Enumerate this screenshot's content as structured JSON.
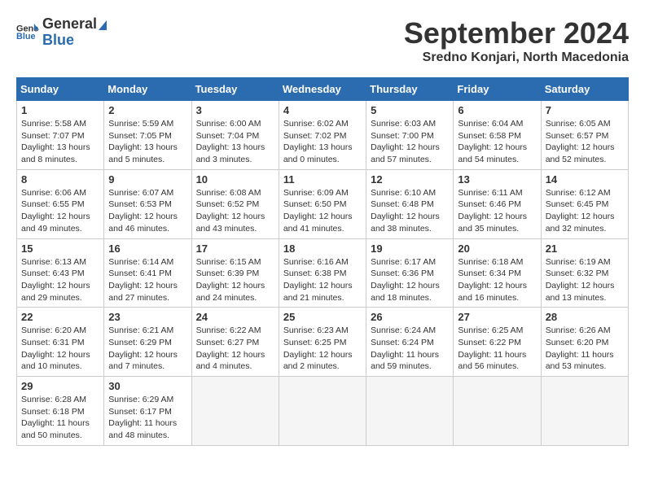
{
  "header": {
    "logo_general": "General",
    "logo_blue": "Blue",
    "month": "September 2024",
    "location": "Sredno Konjari, North Macedonia"
  },
  "weekdays": [
    "Sunday",
    "Monday",
    "Tuesday",
    "Wednesday",
    "Thursday",
    "Friday",
    "Saturday"
  ],
  "weeks": [
    [
      {
        "day": 1,
        "sunrise": "5:58 AM",
        "sunset": "7:07 PM",
        "daylight": "13 hours and 8 minutes."
      },
      {
        "day": 2,
        "sunrise": "5:59 AM",
        "sunset": "7:05 PM",
        "daylight": "13 hours and 5 minutes."
      },
      {
        "day": 3,
        "sunrise": "6:00 AM",
        "sunset": "7:04 PM",
        "daylight": "13 hours and 3 minutes."
      },
      {
        "day": 4,
        "sunrise": "6:02 AM",
        "sunset": "7:02 PM",
        "daylight": "13 hours and 0 minutes."
      },
      {
        "day": 5,
        "sunrise": "6:03 AM",
        "sunset": "7:00 PM",
        "daylight": "12 hours and 57 minutes."
      },
      {
        "day": 6,
        "sunrise": "6:04 AM",
        "sunset": "6:58 PM",
        "daylight": "12 hours and 54 minutes."
      },
      {
        "day": 7,
        "sunrise": "6:05 AM",
        "sunset": "6:57 PM",
        "daylight": "12 hours and 52 minutes."
      }
    ],
    [
      {
        "day": 8,
        "sunrise": "6:06 AM",
        "sunset": "6:55 PM",
        "daylight": "12 hours and 49 minutes."
      },
      {
        "day": 9,
        "sunrise": "6:07 AM",
        "sunset": "6:53 PM",
        "daylight": "12 hours and 46 minutes."
      },
      {
        "day": 10,
        "sunrise": "6:08 AM",
        "sunset": "6:52 PM",
        "daylight": "12 hours and 43 minutes."
      },
      {
        "day": 11,
        "sunrise": "6:09 AM",
        "sunset": "6:50 PM",
        "daylight": "12 hours and 41 minutes."
      },
      {
        "day": 12,
        "sunrise": "6:10 AM",
        "sunset": "6:48 PM",
        "daylight": "12 hours and 38 minutes."
      },
      {
        "day": 13,
        "sunrise": "6:11 AM",
        "sunset": "6:46 PM",
        "daylight": "12 hours and 35 minutes."
      },
      {
        "day": 14,
        "sunrise": "6:12 AM",
        "sunset": "6:45 PM",
        "daylight": "12 hours and 32 minutes."
      }
    ],
    [
      {
        "day": 15,
        "sunrise": "6:13 AM",
        "sunset": "6:43 PM",
        "daylight": "12 hours and 29 minutes."
      },
      {
        "day": 16,
        "sunrise": "6:14 AM",
        "sunset": "6:41 PM",
        "daylight": "12 hours and 27 minutes."
      },
      {
        "day": 17,
        "sunrise": "6:15 AM",
        "sunset": "6:39 PM",
        "daylight": "12 hours and 24 minutes."
      },
      {
        "day": 18,
        "sunrise": "6:16 AM",
        "sunset": "6:38 PM",
        "daylight": "12 hours and 21 minutes."
      },
      {
        "day": 19,
        "sunrise": "6:17 AM",
        "sunset": "6:36 PM",
        "daylight": "12 hours and 18 minutes."
      },
      {
        "day": 20,
        "sunrise": "6:18 AM",
        "sunset": "6:34 PM",
        "daylight": "12 hours and 16 minutes."
      },
      {
        "day": 21,
        "sunrise": "6:19 AM",
        "sunset": "6:32 PM",
        "daylight": "12 hours and 13 minutes."
      }
    ],
    [
      {
        "day": 22,
        "sunrise": "6:20 AM",
        "sunset": "6:31 PM",
        "daylight": "12 hours and 10 minutes."
      },
      {
        "day": 23,
        "sunrise": "6:21 AM",
        "sunset": "6:29 PM",
        "daylight": "12 hours and 7 minutes."
      },
      {
        "day": 24,
        "sunrise": "6:22 AM",
        "sunset": "6:27 PM",
        "daylight": "12 hours and 4 minutes."
      },
      {
        "day": 25,
        "sunrise": "6:23 AM",
        "sunset": "6:25 PM",
        "daylight": "12 hours and 2 minutes."
      },
      {
        "day": 26,
        "sunrise": "6:24 AM",
        "sunset": "6:24 PM",
        "daylight": "11 hours and 59 minutes."
      },
      {
        "day": 27,
        "sunrise": "6:25 AM",
        "sunset": "6:22 PM",
        "daylight": "11 hours and 56 minutes."
      },
      {
        "day": 28,
        "sunrise": "6:26 AM",
        "sunset": "6:20 PM",
        "daylight": "11 hours and 53 minutes."
      }
    ],
    [
      {
        "day": 29,
        "sunrise": "6:28 AM",
        "sunset": "6:18 PM",
        "daylight": "11 hours and 50 minutes."
      },
      {
        "day": 30,
        "sunrise": "6:29 AM",
        "sunset": "6:17 PM",
        "daylight": "11 hours and 48 minutes."
      },
      null,
      null,
      null,
      null,
      null
    ]
  ]
}
